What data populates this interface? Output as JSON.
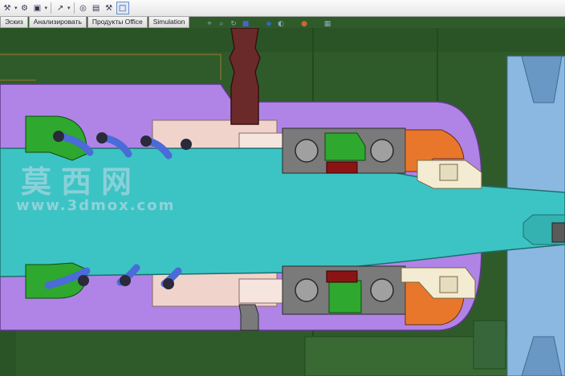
{
  "toolbar": {
    "buttons": [
      "wrench-icon",
      "gear-icon",
      "shaded-view-icon",
      "arrow-icon",
      "binoculars-icon",
      "package-icon",
      "toolbox-icon",
      "display-icon"
    ]
  },
  "tabs": [
    {
      "label": "Эскиз"
    },
    {
      "label": "Анализировать"
    },
    {
      "label": "Продукты Office"
    },
    {
      "label": "Simulation"
    }
  ],
  "view_icons": [
    "zoom-fit-icon",
    "zoom-area-icon",
    "rotate-icon",
    "section-view-icon",
    "view-orientation-icon",
    "display-style-icon",
    "appearance-icon",
    "scene-icon"
  ],
  "watermark": {
    "chinese": "莫西网",
    "url": "www.3dmox.com"
  },
  "colors": {
    "background": "#2f5b2a",
    "housing": "#b084e6",
    "shaft": "#3cc4c4",
    "spring": "#4a6bd8",
    "seal": "#2ea82e",
    "bearing_ring": "#7a7a7a",
    "nut": "#e8772c",
    "cap": "#f4ecd2",
    "sleeve": "#f0d4cc",
    "post": "#6b2a2a",
    "red_key": "#8a1414",
    "right_part": "#8ab8e0"
  }
}
